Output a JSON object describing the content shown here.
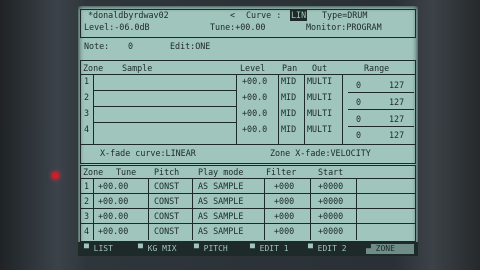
{
  "header": {
    "program_name": "*donaldbyrdwav02",
    "output_arrow": "<",
    "curve_label": "Curve :",
    "curve_value": "LIN",
    "type_label": "Type=DRUM",
    "level": "Level:-06.0dB",
    "tune": "Tune:+00.00",
    "monitor": "Monitor:PROGRAM"
  },
  "note": {
    "note_label": "Note:",
    "note_value": "0",
    "edit_label": "Edit:ONE"
  },
  "zone_table": {
    "headers": [
      "Zone",
      "Sample",
      "Level",
      "Pan",
      "Out",
      "Range"
    ],
    "rows": [
      {
        "zone": "1",
        "sample": "",
        "level": "+00.0",
        "pan": "MID",
        "out": "MULTI",
        "range_lo": "0",
        "range_hi": "127"
      },
      {
        "zone": "2",
        "sample": "",
        "level": "+00.0",
        "pan": "MID",
        "out": "MULTI",
        "range_lo": "0",
        "range_hi": "127"
      },
      {
        "zone": "3",
        "sample": "",
        "level": "+00.0",
        "pan": "MID",
        "out": "MULTI",
        "range_lo": "0",
        "range_hi": "127"
      },
      {
        "zone": "4",
        "sample": "",
        "level": "+00.0",
        "pan": "MID",
        "out": "MULTI",
        "range_lo": "0",
        "range_hi": "127"
      }
    ],
    "xfade_curve": "X-fade curve:LINEAR",
    "zone_xfade": "Zone X-fade:VELOCITY"
  },
  "tune_table": {
    "headers": [
      "Zone",
      "Tune",
      "Pitch",
      "Play mode",
      "Filter",
      "Start"
    ],
    "rows": [
      {
        "zone": "1",
        "tune": "+00.00",
        "pitch": "CONST",
        "play": "AS SAMPLE",
        "filter": "+000",
        "start": "+0000"
      },
      {
        "zone": "2",
        "tune": "+00.00",
        "pitch": "CONST",
        "play": "AS SAMPLE",
        "filter": "+000",
        "start": "+0000"
      },
      {
        "zone": "3",
        "tune": "+00.00",
        "pitch": "CONST",
        "play": "AS SAMPLE",
        "filter": "+000",
        "start": "+0000"
      },
      {
        "zone": "4",
        "tune": "+00.00",
        "pitch": "CONST",
        "play": "AS SAMPLE",
        "filter": "+000",
        "start": "+0000"
      }
    ]
  },
  "tabs": [
    "LIST",
    "KG MIX",
    "PITCH",
    "EDIT 1",
    "EDIT 2",
    "ZONE"
  ],
  "colors": {
    "lcd": "#9fc5bd",
    "ink": "#1d2a27",
    "led": "#d01c2c"
  }
}
